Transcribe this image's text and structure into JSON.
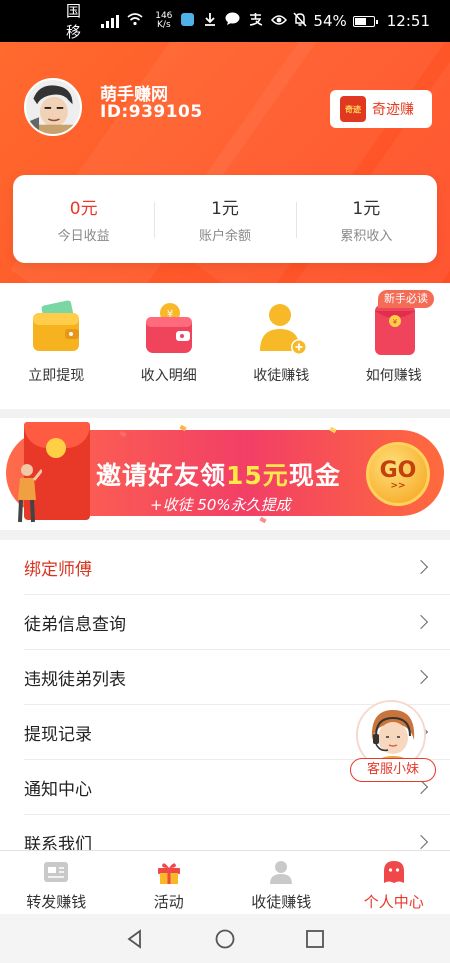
{
  "status_bar": {
    "carrier": "中国移动",
    "network": "4G",
    "speed_value": "146",
    "speed_unit": "K/s",
    "battery": "54%",
    "time": "12:51"
  },
  "profile": {
    "name": "萌手赚网",
    "id_text": "ID:939105",
    "partner_logo_text": "奇迹",
    "partner_button": "奇迹赚"
  },
  "stats": [
    {
      "value": "0元",
      "label": "今日收益"
    },
    {
      "value": "1元",
      "label": "账户余额"
    },
    {
      "value": "1元",
      "label": "累积收入"
    }
  ],
  "quick_actions": [
    {
      "label": "立即提现",
      "icon": "wallet-icon"
    },
    {
      "label": "收入明细",
      "icon": "coin-purse-icon"
    },
    {
      "label": "收徒赚钱",
      "icon": "add-person-icon"
    },
    {
      "label": "如何赚钱",
      "icon": "red-envelope-icon"
    }
  ],
  "new_user_badge": "新手必读",
  "banner": {
    "title_pre": "邀请好友领",
    "title_highlight": "15元",
    "title_post": "现金",
    "subtitle": "+收徒 50%永久提成",
    "go_label": "GO",
    "go_sub": ">>"
  },
  "menu": [
    {
      "label": "绑定师傅",
      "highlight": true
    },
    {
      "label": "徒弟信息查询"
    },
    {
      "label": "违规徒弟列表"
    },
    {
      "label": "提现记录"
    },
    {
      "label": "通知中心"
    },
    {
      "label": "联系我们"
    }
  ],
  "customer_service": "客服小妹",
  "bottom_nav": [
    {
      "label": "转发赚钱",
      "icon": "share-card-icon"
    },
    {
      "label": "活动",
      "icon": "gift-icon"
    },
    {
      "label": "收徒赚钱",
      "icon": "person-icon"
    },
    {
      "label": "个人中心",
      "icon": "profile-face-icon",
      "active": true
    }
  ],
  "colors": {
    "brand": "#ff5a2a",
    "accent_red": "#e8392a",
    "highlight_yellow": "#ffe84a"
  }
}
